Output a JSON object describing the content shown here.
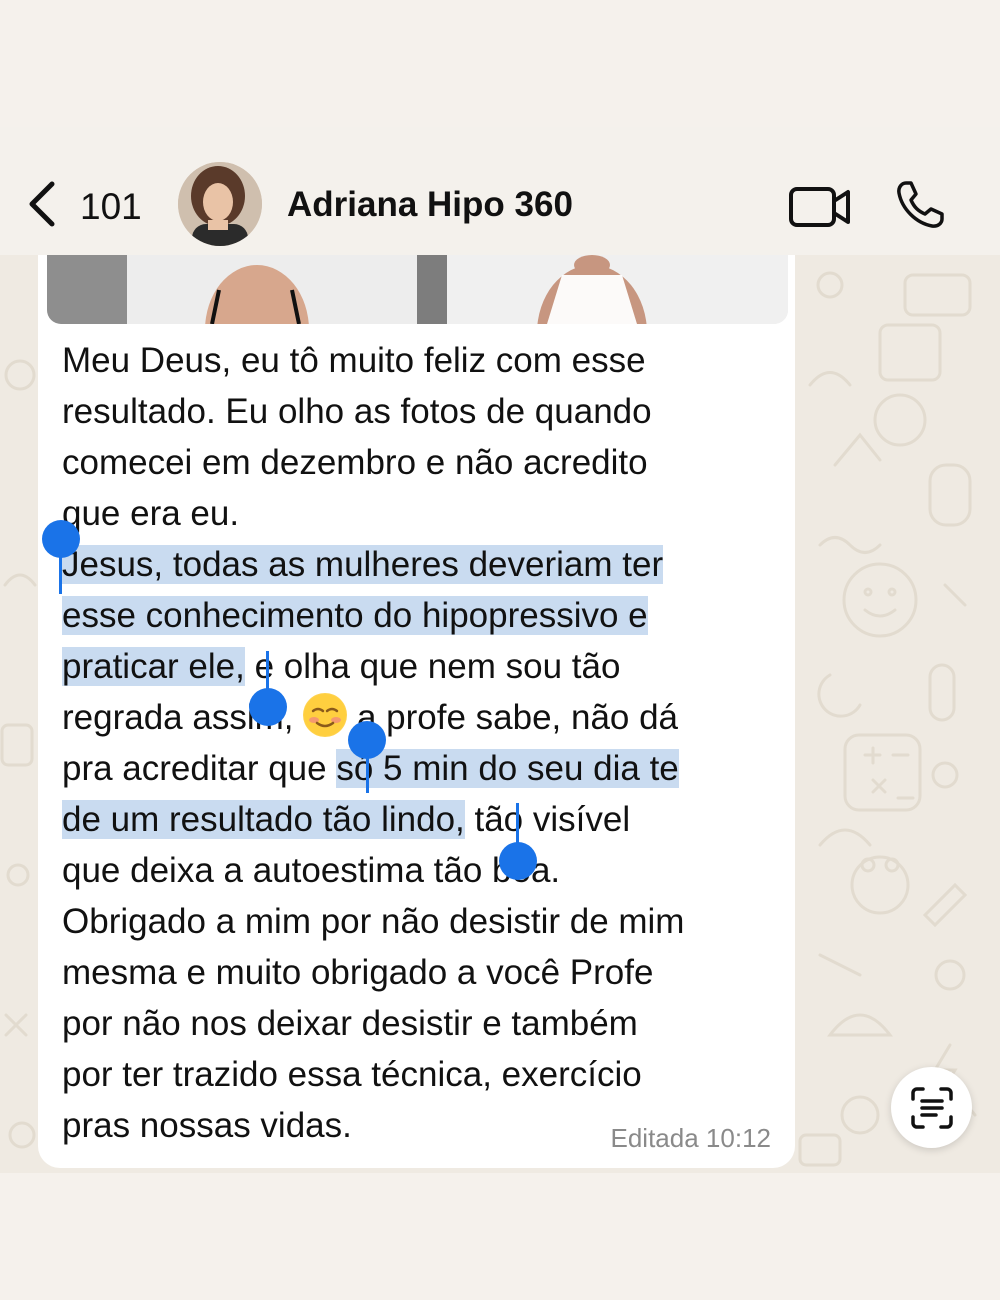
{
  "header": {
    "unread_count": "101",
    "contact_name": "Adriana Hipo 360",
    "icons": {
      "back": "chevron-left-icon",
      "video": "video-camera-icon",
      "call": "phone-icon"
    }
  },
  "message": {
    "lines": [
      {
        "segments": [
          {
            "text": "Meu Deus, eu tô muito feliz com esse",
            "selected": false
          }
        ]
      },
      {
        "segments": [
          {
            "text": "resultado. Eu olho as fotos de quando",
            "selected": false
          }
        ]
      },
      {
        "segments": [
          {
            "text": "comecei em dezembro e não acredito",
            "selected": false
          }
        ]
      },
      {
        "segments": [
          {
            "text": "que era eu.",
            "selected": false
          }
        ]
      },
      {
        "segments": [
          {
            "text": "Jesus, todas as mulheres deveriam ter",
            "selected": true
          }
        ]
      },
      {
        "segments": [
          {
            "text": "esse conhecimento do hipopressivo e",
            "selected": true
          }
        ]
      },
      {
        "segments": [
          {
            "text": "praticar ele,",
            "selected": true
          },
          {
            "text": " e olha que nem sou tão",
            "selected": false
          }
        ]
      },
      {
        "segments": [
          {
            "text": "regrada assim, ",
            "selected": false
          },
          {
            "text": "EMOJI",
            "selected": false
          },
          {
            "text": " a profe sabe, não dá",
            "selected": false
          }
        ]
      },
      {
        "segments": [
          {
            "text": "pra acreditar que ",
            "selected": false
          },
          {
            "text": "só 5 min do seu dia te",
            "selected": true
          }
        ]
      },
      {
        "segments": [
          {
            "text": "de um resultado tão lindo,",
            "selected": true
          },
          {
            "text": " tão visível",
            "selected": false
          }
        ]
      },
      {
        "segments": [
          {
            "text": "que deixa a autoestima tão boa.",
            "selected": false
          }
        ]
      },
      {
        "segments": [
          {
            "text": "Obrigado a mim por não desistir de mim",
            "selected": false
          }
        ]
      },
      {
        "segments": [
          {
            "text": "mesma e muito obrigado a você Profe",
            "selected": false
          }
        ]
      },
      {
        "segments": [
          {
            "text": "por não nos deixar desistir e também",
            "selected": false
          }
        ]
      },
      {
        "segments": [
          {
            "text": "por ter trazido essa técnica, exercício",
            "selected": false
          }
        ]
      },
      {
        "segments": [
          {
            "text": "pras nossas vidas.",
            "selected": false
          }
        ]
      }
    ],
    "emoji": "smiling-blushing-face-emoji",
    "status": "Editada",
    "time": "10:12"
  },
  "floating_button": {
    "icon": "text-scan-icon"
  },
  "colors": {
    "selection": "#c9dbf0",
    "handle": "#1a73e8",
    "bubble": "#ffffff",
    "chat_bg": "#efeae2"
  }
}
